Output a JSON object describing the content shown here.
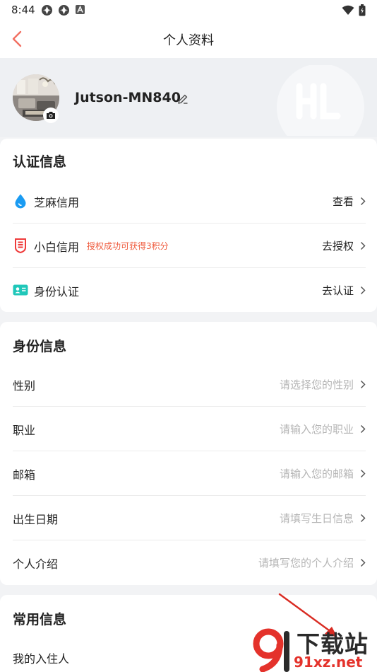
{
  "status_bar": {
    "time": "8:44"
  },
  "nav": {
    "title": "个人资料",
    "back_icon": "chevron-left-icon",
    "accent_color": "#f27062"
  },
  "profile": {
    "username": "Jutson-MN840",
    "avatar_icon": "avatar-photo",
    "camera_icon": "camera-icon",
    "edit_icon": "pencil-icon"
  },
  "auth_section": {
    "title": "认证信息",
    "items": [
      {
        "label": "芝麻信用",
        "hint": "",
        "value": "查看",
        "icon": "sesame-credit-icon"
      },
      {
        "label": "小白信用",
        "hint": "授权成功可获得3积分",
        "value": "去授权",
        "icon": "xiaobai-credit-icon"
      },
      {
        "label": "身份认证",
        "hint": "",
        "value": "去认证",
        "icon": "id-card-icon"
      }
    ]
  },
  "identity_section": {
    "title": "身份信息",
    "items": [
      {
        "label": "性别",
        "placeholder": "请选择您的性别"
      },
      {
        "label": "职业",
        "placeholder": "请输入您的职业"
      },
      {
        "label": "邮箱",
        "placeholder": "请输入您的邮箱"
      },
      {
        "label": "出生日期",
        "placeholder": "请填写生日信息"
      },
      {
        "label": "个人介绍",
        "placeholder": "请填写您的个人介绍"
      }
    ]
  },
  "common_section": {
    "title": "常用信息",
    "items": [
      {
        "label": "我的入住人"
      }
    ]
  },
  "watermark": {
    "top_text": "下载站",
    "bottom_text": "91xz.net"
  }
}
